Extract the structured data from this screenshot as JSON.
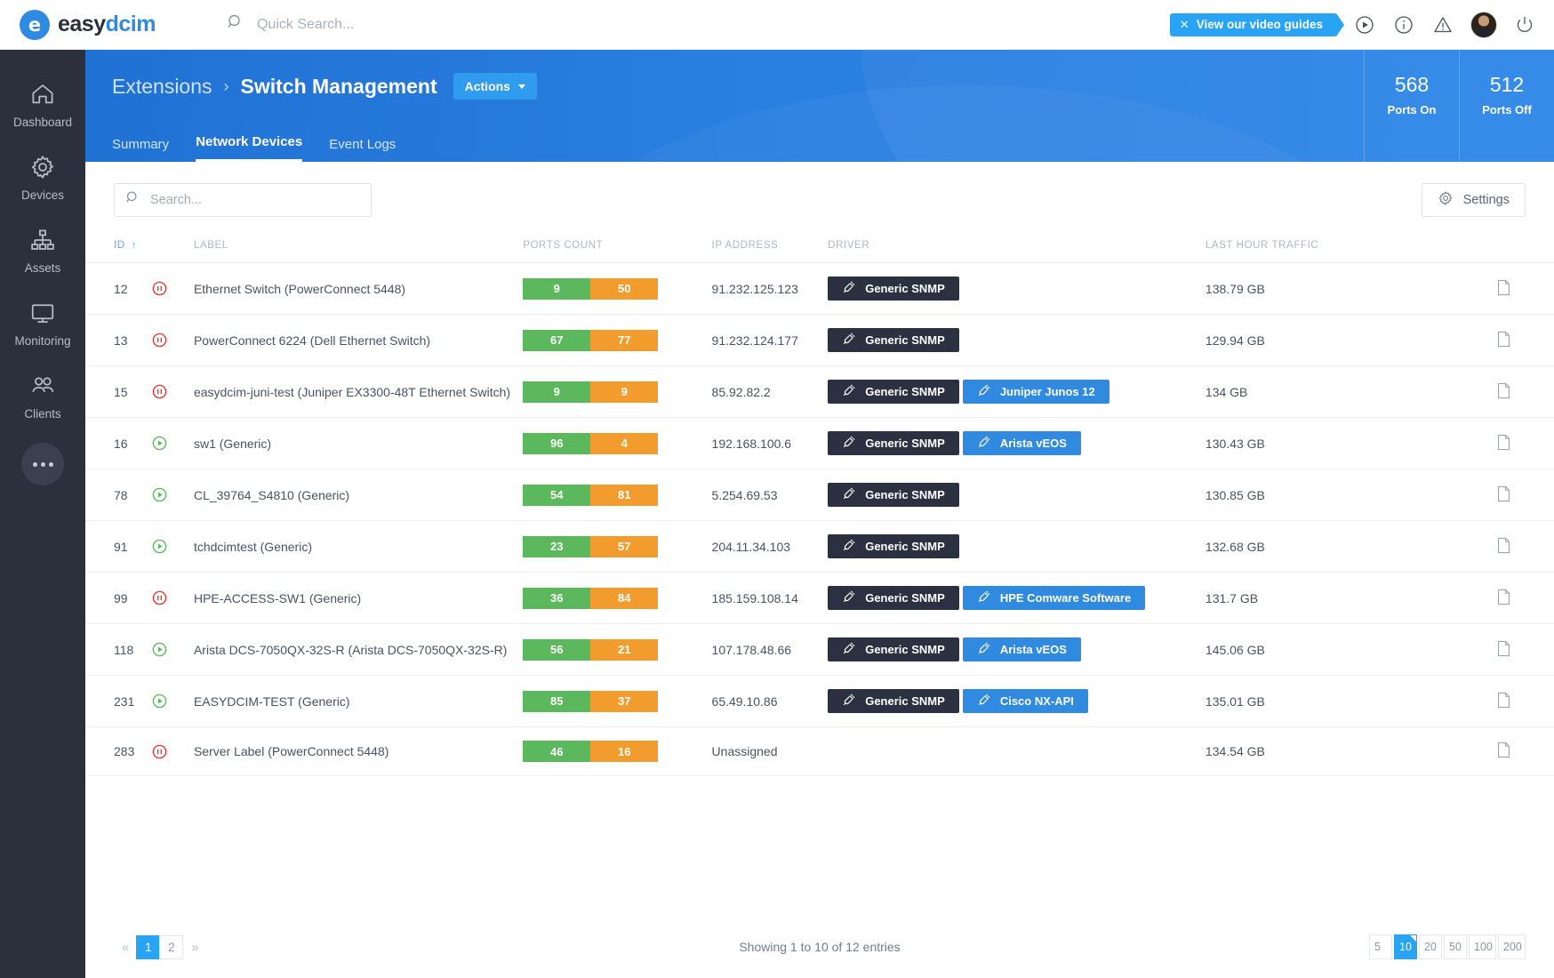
{
  "topbar": {
    "logo_easy": "easy",
    "logo_dcim": "dcim",
    "logo_initial": "e",
    "quick_search_placeholder": "Quick Search...",
    "video_guides_label": "View our video guides",
    "video_guides_close": "✕",
    "icons": [
      "play-circle-icon",
      "info-icon",
      "warning-icon",
      "avatar",
      "power-icon"
    ]
  },
  "sidebar": {
    "items": [
      {
        "label": "Dashboard",
        "icon": "home-icon"
      },
      {
        "label": "Devices",
        "icon": "gear-icon"
      },
      {
        "label": "Assets",
        "icon": "sitemap-icon"
      },
      {
        "label": "Monitoring",
        "icon": "monitor-icon"
      },
      {
        "label": "Clients",
        "icon": "users-icon"
      }
    ],
    "more_label": "more-menu"
  },
  "header": {
    "breadcrumb_parent": "Extensions",
    "breadcrumb_sep": "›",
    "breadcrumb_current": "Switch Management",
    "actions_label": "Actions",
    "tabs": [
      {
        "label": "Summary",
        "active": false
      },
      {
        "label": "Network Devices",
        "active": true
      },
      {
        "label": "Event Logs",
        "active": false
      }
    ],
    "stats": [
      {
        "value": "568",
        "label": "Ports On"
      },
      {
        "value": "512",
        "label": "Ports Off"
      }
    ]
  },
  "toolbar": {
    "search_placeholder": "Search...",
    "search_value": "",
    "settings_label": "Settings"
  },
  "table": {
    "columns": [
      "ID",
      "",
      "LABEL",
      "PORTS COUNT",
      "IP ADDRESS",
      "DRIVER",
      "LAST HOUR TRAFFIC",
      ""
    ],
    "sorted_column": "ID",
    "sort_direction": "asc",
    "sort_arrow": "↑",
    "rows": [
      {
        "id": "12",
        "status": "paused",
        "label": "Ethernet Switch (PowerConnect 5448)",
        "ports_on": "9",
        "ports_off": "50",
        "ip": "91.232.125.123",
        "drivers": [
          "Generic SNMP"
        ],
        "traffic": "138.79 GB"
      },
      {
        "id": "13",
        "status": "paused",
        "label": "PowerConnect 6224 (Dell Ethernet Switch)",
        "ports_on": "67",
        "ports_off": "77",
        "ip": "91.232.124.177",
        "drivers": [
          "Generic SNMP"
        ],
        "traffic": "129.94 GB"
      },
      {
        "id": "15",
        "status": "paused",
        "label": "easydcim-juni-test (Juniper EX3300-48T Ethernet Switch)",
        "ports_on": "9",
        "ports_off": "9",
        "ip": "85.92.82.2",
        "drivers": [
          "Generic SNMP",
          "Juniper Junos 12"
        ],
        "traffic": "134 GB"
      },
      {
        "id": "16",
        "status": "running",
        "label": "sw1 (Generic)",
        "ports_on": "96",
        "ports_off": "4",
        "ip": "192.168.100.6",
        "drivers": [
          "Generic SNMP",
          "Arista vEOS"
        ],
        "traffic": "130.43 GB"
      },
      {
        "id": "78",
        "status": "running",
        "label": "CL_39764_S4810 (Generic)",
        "ports_on": "54",
        "ports_off": "81",
        "ip": "5.254.69.53",
        "drivers": [
          "Generic SNMP"
        ],
        "traffic": "130.85 GB"
      },
      {
        "id": "91",
        "status": "running",
        "label": "tchdcimtest (Generic)",
        "ports_on": "23",
        "ports_off": "57",
        "ip": "204.11.34.103",
        "drivers": [
          "Generic SNMP"
        ],
        "traffic": "132.68 GB"
      },
      {
        "id": "99",
        "status": "paused",
        "label": "HPE-ACCESS-SW1 (Generic)",
        "ports_on": "36",
        "ports_off": "84",
        "ip": "185.159.108.14",
        "drivers": [
          "Generic SNMP",
          "HPE Comware Software"
        ],
        "traffic": "131.7 GB"
      },
      {
        "id": "118",
        "status": "running",
        "label": "Arista DCS-7050QX-32S-R (Arista DCS-7050QX-32S-R)",
        "ports_on": "56",
        "ports_off": "21",
        "ip": "107.178.48.66",
        "drivers": [
          "Generic SNMP",
          "Arista vEOS"
        ],
        "traffic": "145.06 GB"
      },
      {
        "id": "231",
        "status": "running",
        "label": "EASYDCIM-TEST (Generic)",
        "ports_on": "85",
        "ports_off": "37",
        "ip": "65.49.10.86",
        "drivers": [
          "Generic SNMP",
          "Cisco NX-API"
        ],
        "traffic": "135.01 GB"
      },
      {
        "id": "283",
        "status": "paused",
        "label": "Server Label (PowerConnect 5448)",
        "ports_on": "46",
        "ports_off": "16",
        "ip": "Unassigned",
        "drivers": [],
        "traffic": "134.54 GB"
      }
    ]
  },
  "footer": {
    "prev_label": "«",
    "next_label": "»",
    "pages": [
      "1",
      "2"
    ],
    "active_page": "1",
    "showing_text": "Showing 1 to 10 of 12 entries",
    "page_sizes": [
      "5",
      "10",
      "20",
      "50",
      "100",
      "200"
    ],
    "active_page_size": "10"
  },
  "colors": {
    "brand_blue": "#2f8ae0",
    "accent_blue": "#29a4f5",
    "sidebar_dark": "#2b303c",
    "ports_on_green": "#5cb85c",
    "ports_off_orange": "#f39c2e",
    "driver_dark": "#2b3140",
    "status_red": "#e8352e",
    "status_green": "#5cb85c"
  }
}
